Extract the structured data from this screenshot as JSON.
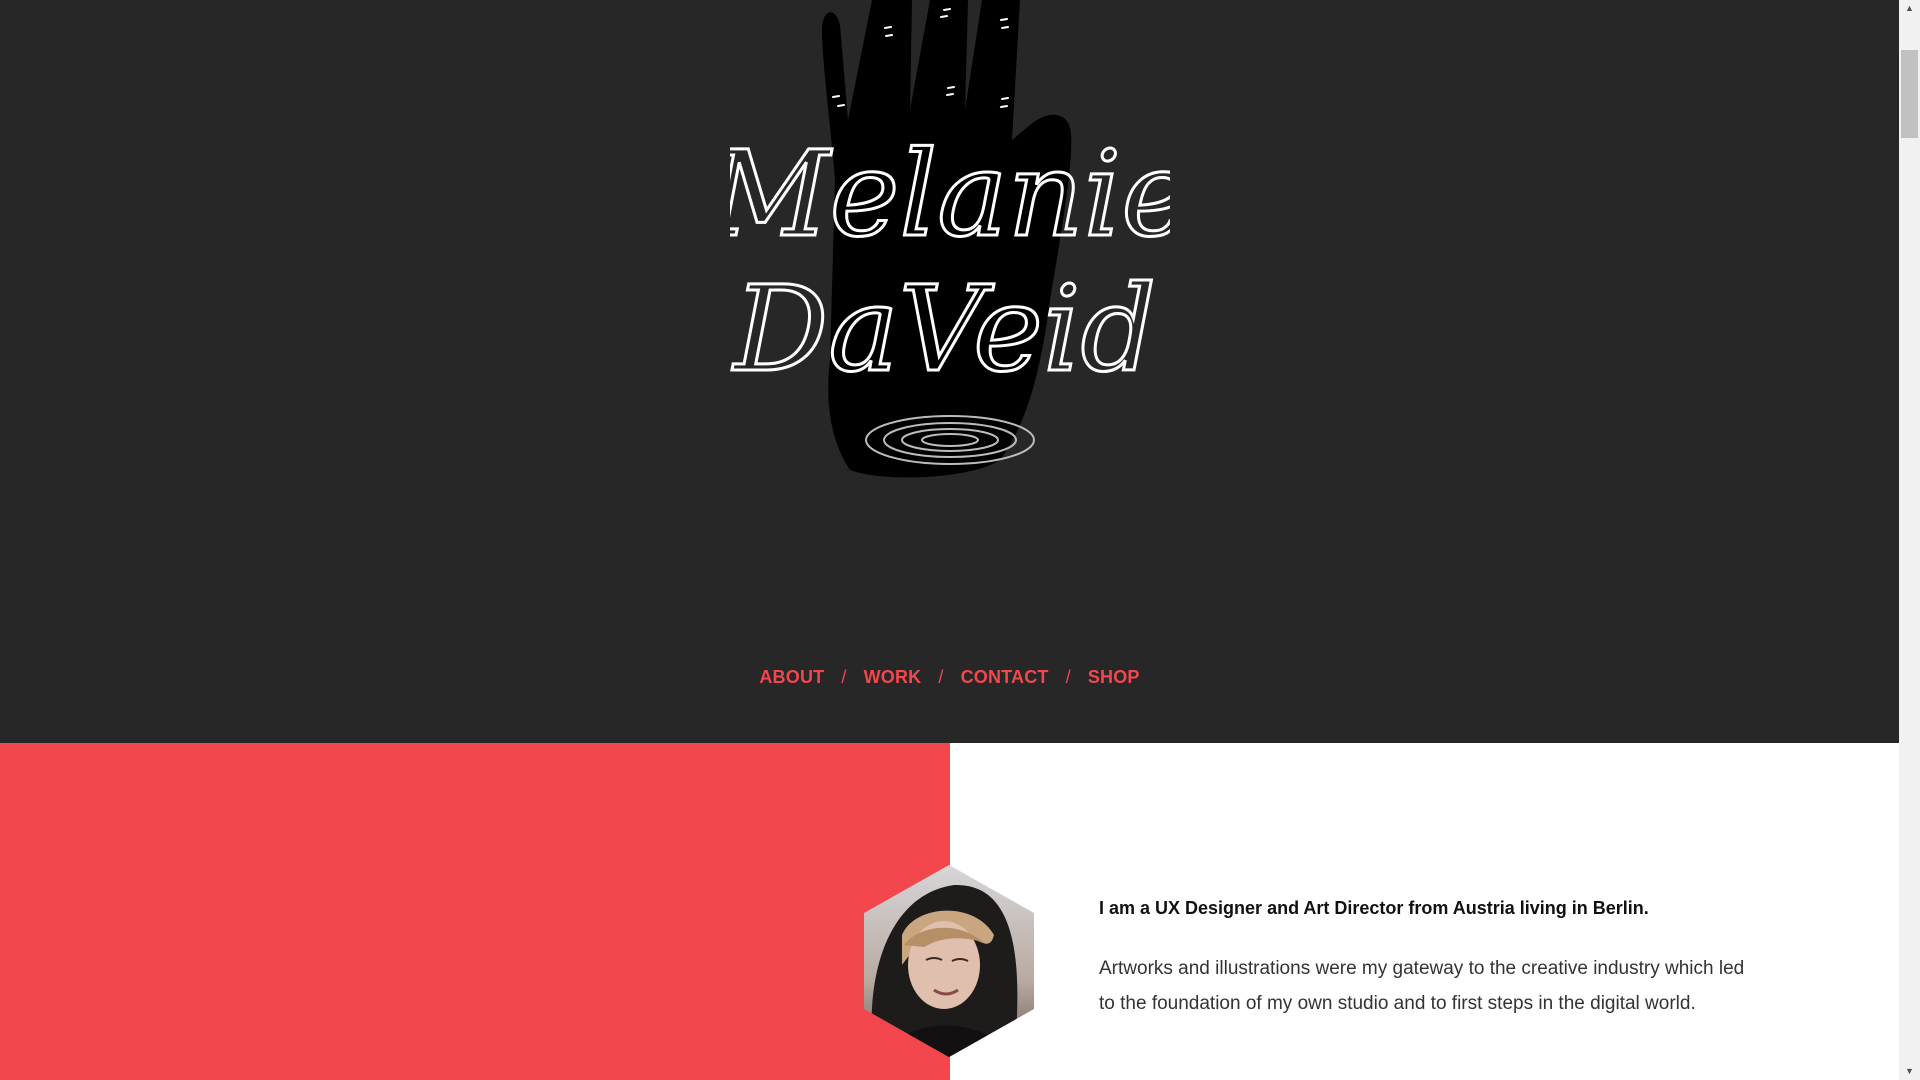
{
  "logo": {
    "line1": "Melanie",
    "line2": "DaVeid"
  },
  "nav": {
    "items": [
      {
        "label": "ABOUT"
      },
      {
        "label": "WORK"
      },
      {
        "label": "CONTACT"
      },
      {
        "label": "SHOP"
      }
    ],
    "separator": "/"
  },
  "about": {
    "lead": "I am a UX Designer and Art Director from Austria living in Berlin.",
    "body": "Artworks and illustrations were my gateway to the creative industry which led to the foundation of my own studio and to first steps in the digital world."
  },
  "colors": {
    "hero_bg": "#272727",
    "accent": "#f4464d",
    "text": "#111111"
  },
  "icons": {
    "scroll_up": "scroll-up-arrow-icon",
    "scroll_down": "scroll-down-arrow-icon"
  }
}
